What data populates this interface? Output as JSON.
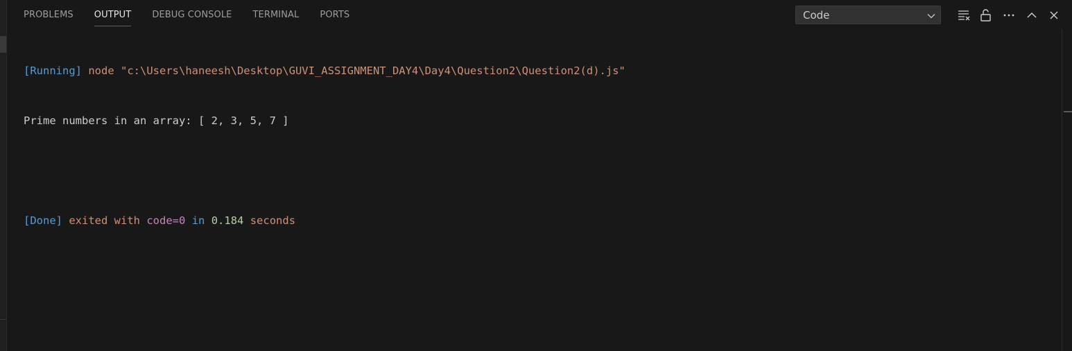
{
  "panel": {
    "tabs": [
      {
        "label": "PROBLEMS"
      },
      {
        "label": "OUTPUT"
      },
      {
        "label": "DEBUG CONSOLE"
      },
      {
        "label": "TERMINAL"
      },
      {
        "label": "PORTS"
      }
    ],
    "active_tab": "OUTPUT"
  },
  "channel_select": {
    "selected": "Code"
  },
  "toolbar": {
    "icons": [
      "clear-output-icon",
      "lock-scroll-icon",
      "more-actions-icon",
      "maximize-panel-icon",
      "close-panel-icon"
    ]
  },
  "output": {
    "running_tag": "[Running]",
    "command": "node \"c:\\Users\\haneesh\\Desktop\\GUVI_ASSIGNMENT_DAY4\\Day4\\Question2\\Question2(d).js\"",
    "result": "Prime numbers in an array: [ 2, 3, 5, 7 ]",
    "done_tag": "[Done]",
    "exited_with": "exited with",
    "code": "code=0",
    "in_word": "in",
    "duration": "0.184",
    "seconds": "seconds"
  },
  "colors": {
    "background": "#181818",
    "tag_blue": "#569cd6",
    "string_orange": "#ce9178",
    "code_purple": "#c586c0",
    "number_green": "#b5cea8",
    "active_tab_underline": "#0078d4"
  }
}
